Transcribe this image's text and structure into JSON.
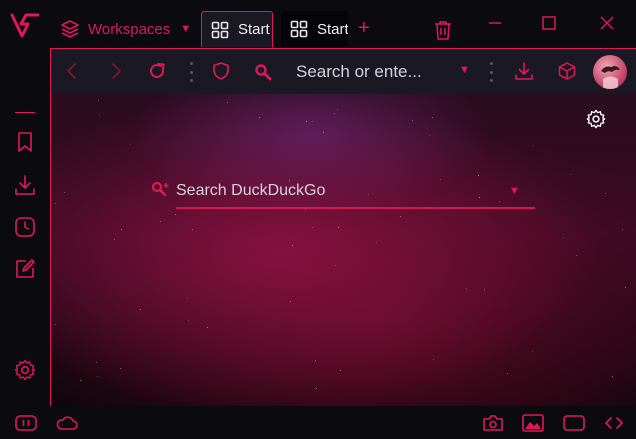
{
  "colors": {
    "accent": "#e0185a",
    "chrome": "#0b0a0f",
    "toolbar": "#1a1822"
  },
  "titlebar": {
    "logo_icon": "vivaldi-logo-icon",
    "workspaces_label": "Workspaces",
    "tabs": [
      {
        "label": "Start",
        "active": true,
        "icon": "grid-icon"
      },
      {
        "label": "Start",
        "active": false,
        "icon": "grid-icon"
      }
    ],
    "new_tab_glyph": "+",
    "window_controls": [
      "minimize-icon",
      "maximize-icon",
      "close-icon"
    ]
  },
  "addressbar": {
    "placeholder": "Search or ente...",
    "icons": [
      "back-icon",
      "forward-icon",
      "reload-icon",
      "shield-icon",
      "search-icon",
      "download-icon",
      "cube-icon"
    ]
  },
  "startpage": {
    "search_placeholder": "Search DuckDuckGo",
    "icons": [
      "settings-icon",
      "search-engine-icon"
    ]
  },
  "sidepanel": {
    "icons": [
      "bookmarks-icon",
      "downloads-icon",
      "history-icon",
      "notes-icon",
      "settings-icon"
    ]
  },
  "statusbar": {
    "icons": [
      "panel-toggle-icon",
      "sync-cloud-icon",
      "capture-icon",
      "image-icon",
      "window-icon",
      "code-icon"
    ]
  }
}
